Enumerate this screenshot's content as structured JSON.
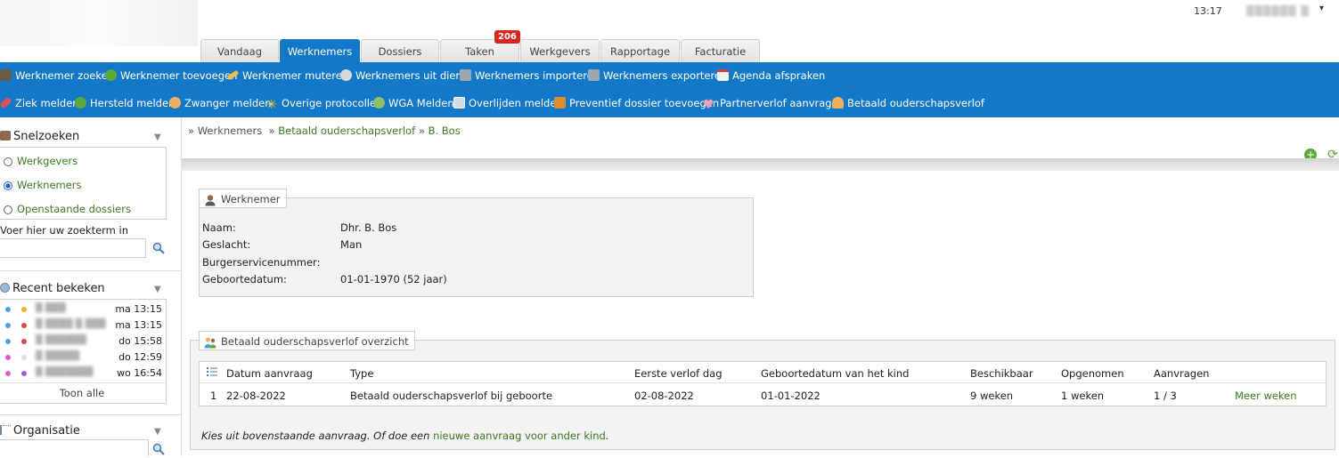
{
  "header": {
    "clock": "13:17",
    "user_name": "▒▒▒▒▒▒ ▒",
    "caret": "▾"
  },
  "tabs": [
    {
      "label": "Vandaag"
    },
    {
      "label": "Werknemers"
    },
    {
      "label": "Dossiers"
    },
    {
      "label": "Taken",
      "badge": "206"
    },
    {
      "label": "Werkgevers"
    },
    {
      "label": "Rapportage"
    },
    {
      "label": "Facturatie"
    }
  ],
  "toolbar1": [
    {
      "label": "Werknemer zoeken",
      "icon": "search-person-icon"
    },
    {
      "label": "Werknemer toevoegen",
      "icon": "add-icon"
    },
    {
      "label": "Werknemer muteren",
      "icon": "pencil-icon"
    },
    {
      "label": "Werknemers uit dienst",
      "icon": "clock-person-icon"
    },
    {
      "label": "Werknemers importeren",
      "icon": "import-icon"
    },
    {
      "label": "Werknemers exporteren",
      "icon": "export-icon"
    },
    {
      "label": "Agenda afspraken",
      "icon": "calendar-icon"
    }
  ],
  "toolbar2": [
    {
      "label": "Ziek melden",
      "icon": "pill-icon"
    },
    {
      "label": "Hersteld melden",
      "icon": "check-icon"
    },
    {
      "label": "Zwanger melden",
      "icon": "baby-icon"
    },
    {
      "label": "Overige protocollen",
      "icon": "sparkle-icon"
    },
    {
      "label": "WGA Melden",
      "icon": "recycle-icon"
    },
    {
      "label": "Overlijden melden",
      "icon": "window-icon"
    },
    {
      "label": "Preventief dossier toevoegen",
      "icon": "folder-icon"
    },
    {
      "label": "Partnerverlof aanvragen",
      "icon": "heart-icon"
    },
    {
      "label": "Betaald ouderschapsverlof",
      "icon": "family-icon"
    }
  ],
  "sidebar": {
    "snelzoeken": {
      "title": "Snelzoeken",
      "options": [
        {
          "label": "Werkgevers",
          "selected": false
        },
        {
          "label": "Werknemers",
          "selected": true
        },
        {
          "label": "Openstaande dossiers",
          "selected": false
        }
      ],
      "search_label": "Voer hier uw zoekterm in",
      "search_value": ""
    },
    "recent": {
      "title": "Recent bekeken",
      "items": [
        {
          "name": "▒ ▒▒▒",
          "time": "ma 13:15",
          "dot1": "#4aa3df",
          "dot2": "#f0b429"
        },
        {
          "name": "▒ ▒▒▒▒ ▒ ▒▒▒",
          "time": "ma 13:15",
          "dot1": "#4aa3df",
          "dot2": "#e04848"
        },
        {
          "name": "▒ ▒▒▒▒▒▒",
          "time": "do 15:58",
          "dot1": "#4aa3df",
          "dot2": "#e04848"
        },
        {
          "name": "▒ ▒▒▒▒▒",
          "time": "do 12:59",
          "dot1": "#e05ad6",
          "dot2": "#dddddd"
        },
        {
          "name": "▒ ▒▒▒▒▒▒▒",
          "time": "wo 16:54",
          "dot1": "#e05ad6",
          "dot2": "#a35ad6"
        }
      ],
      "show_all": "Toon alle"
    },
    "organisatie": {
      "title": "Organisatie"
    }
  },
  "breadcrumb": {
    "sep": "»",
    "root": "Werknemers",
    "section": "Betaald ouderschapsverlof",
    "current": "B. Bos"
  },
  "werknemer": {
    "legend": "Werknemer",
    "fields": [
      {
        "label": "Naam:",
        "value": "Dhr. B. Bos"
      },
      {
        "label": "Geslacht:",
        "value": "Man"
      },
      {
        "label": "Burgerservicenummer:",
        "value": ""
      },
      {
        "label": "Geboortedatum:",
        "value": "01-01-1970 (52 jaar)"
      }
    ]
  },
  "overzicht": {
    "legend": "Betaald ouderschapsverlof overzicht",
    "columns": [
      "Datum aanvraag",
      "Type",
      "Eerste verlof dag",
      "Geboortedatum van het kind",
      "Beschikbaar",
      "Opgenomen",
      "Aanvragen"
    ],
    "rows": [
      {
        "nr": "1",
        "datum": "22-08-2022",
        "type": "Betaald ouderschapsverlof bij geboorte",
        "eerste": "02-08-2022",
        "geboorte": "01-01-2022",
        "beschikbaar": "9 weken",
        "opgenomen": "1 weken",
        "aanvragen": "1 / 3",
        "action": "Meer weken"
      }
    ],
    "footer_text": "Kies uit bovenstaande aanvraag. Of doe een",
    "footer_link": "nieuwe aanvraag voor ander kind",
    "footer_end": "."
  }
}
